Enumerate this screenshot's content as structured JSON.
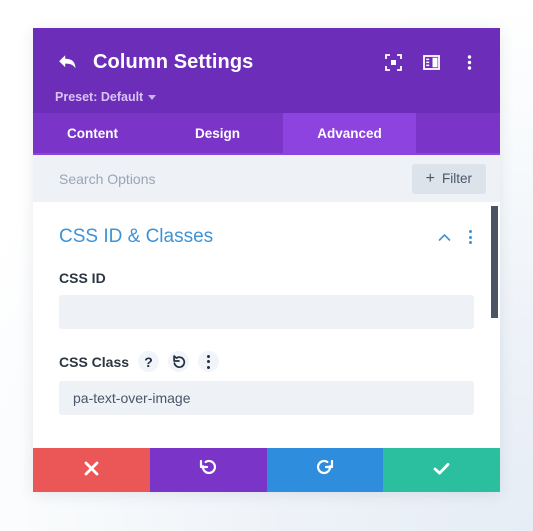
{
  "header": {
    "title": "Column Settings",
    "back_icon": "back-arrow-icon",
    "preset_label": "Preset: Default",
    "actions": [
      {
        "name": "focus-target-icon"
      },
      {
        "name": "layout-panel-icon"
      },
      {
        "name": "more-options-icon"
      }
    ]
  },
  "tabs": [
    {
      "label": "Content",
      "active": false
    },
    {
      "label": "Design",
      "active": false
    },
    {
      "label": "Advanced",
      "active": true
    }
  ],
  "search": {
    "placeholder": "Search Options",
    "value": "",
    "filter_label": "Filter",
    "filter_plus": "+"
  },
  "section": {
    "title": "CSS ID & Classes",
    "collapse_icon": "chevron-up-icon",
    "menu_icon": "more-options-icon"
  },
  "fields": [
    {
      "label": "CSS ID",
      "value": "",
      "placeholder": "",
      "icons": []
    },
    {
      "label": "CSS Class",
      "value": "pa-text-over-image",
      "placeholder": "",
      "icons": [
        {
          "name": "help-icon",
          "glyph": "?"
        },
        {
          "name": "reset-icon",
          "glyph": "undo-arrow"
        },
        {
          "name": "more-options-icon",
          "glyph": "kebab"
        }
      ]
    }
  ],
  "footer": [
    {
      "name": "cancel-button",
      "icon": "close-icon",
      "color": "#eb5757"
    },
    {
      "name": "undo-button",
      "icon": "undo-icon",
      "color": "#7a35c8"
    },
    {
      "name": "redo-button",
      "icon": "redo-icon",
      "color": "#2e8ddc"
    },
    {
      "name": "save-button",
      "icon": "check-icon",
      "color": "#2bbfa0"
    }
  ],
  "colors": {
    "header_purple": "#6c2eb9",
    "tabbar_purple": "#7a35c8",
    "active_tab_purple": "#8c43e0",
    "section_blue": "#3e93d8",
    "field_bg": "#eef1f6",
    "scrollbar": "#4a5464"
  }
}
